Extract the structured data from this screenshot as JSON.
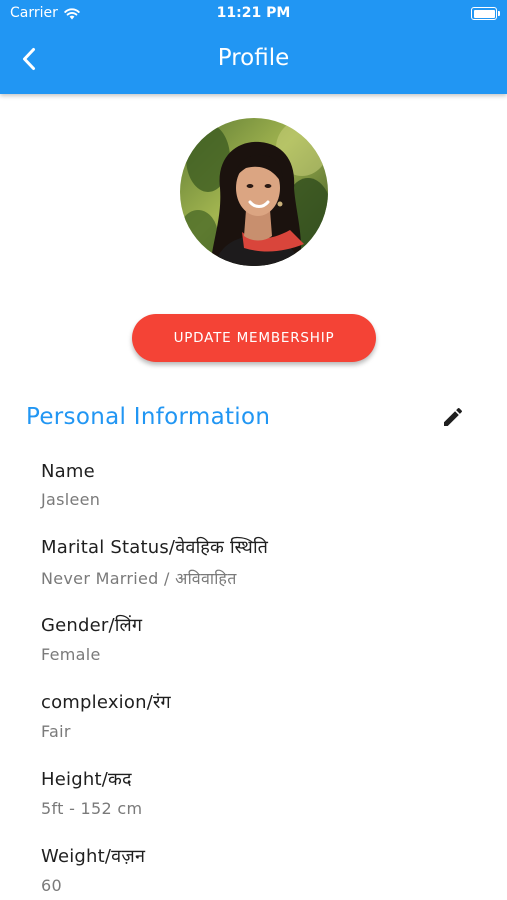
{
  "status_bar": {
    "carrier": "Carrier",
    "time": "11:21 PM",
    "battery_level": 1.0
  },
  "app_bar": {
    "title": "Profile",
    "back_icon": "chevron-left-icon",
    "color": "#2196F3"
  },
  "profile": {
    "avatar": "profile-photo"
  },
  "membership_button": {
    "label": "UPDATE MEMBERSHIP",
    "color": "#F44336"
  },
  "personal_info": {
    "title": "Personal Information",
    "edit_icon": "pencil-icon",
    "fields": [
      {
        "label": "Name",
        "value": "Jasleen"
      },
      {
        "label": "Marital Status/वेवहिक स्थिति",
        "value": "Never Married / अविवाहित"
      },
      {
        "label": "Gender/लिंग",
        "value": "Female"
      },
      {
        "label": "complexion/रंग",
        "value": "Fair"
      },
      {
        "label": "Height/कद",
        "value": "5ft - 152 cm"
      },
      {
        "label": "Weight/वज़न",
        "value": "60"
      }
    ]
  }
}
